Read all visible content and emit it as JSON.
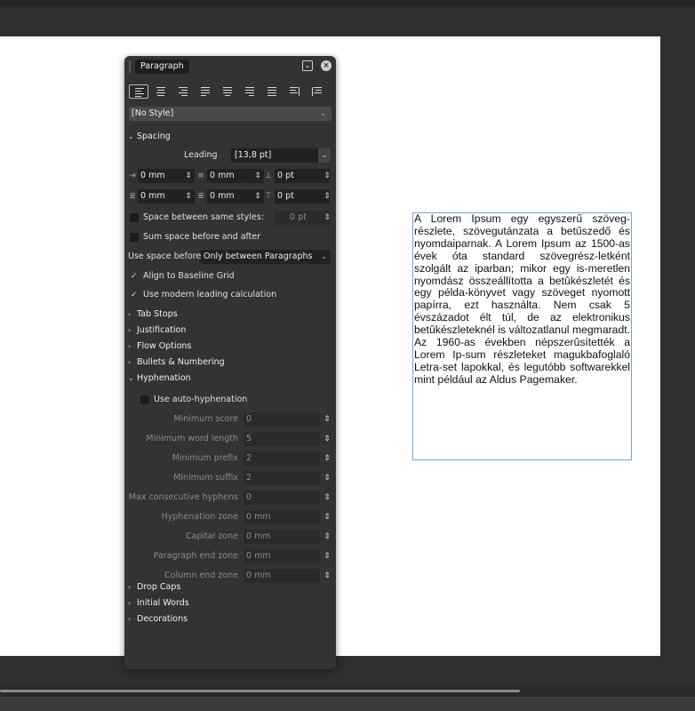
{
  "panel": {
    "tab_label": "Paragraph",
    "style_value": "[No Style]",
    "sections": {
      "spacing": "Spacing",
      "tab_stops": "Tab Stops",
      "justification": "Justification",
      "flow_options": "Flow Options",
      "bullets": "Bullets & Numbering",
      "hyphenation": "Hyphenation",
      "drop_caps": "Drop Caps",
      "initial_words": "Initial Words",
      "decorations": "Decorations"
    },
    "spacing": {
      "leading_label": "Leading",
      "leading_value": "[13,8 pt]",
      "left_indent": "0 mm",
      "first_line_indent": "0 mm",
      "space_before": "0 pt",
      "right_indent": "0 mm",
      "last_line_indent": "0 mm",
      "space_after": "0 pt",
      "space_between_same_label": "Space between same styles:",
      "space_between_same_value": "0 pt",
      "sum_space_label": "Sum space before and after",
      "use_space_before_label": "Use space before",
      "use_space_before_value": "Only between Paragraphs",
      "align_baseline_label": "Align to Baseline Grid",
      "modern_leading_label": "Use modern leading calculation"
    },
    "hyphenation": {
      "auto_label": "Use auto-hyphenation",
      "rows": [
        {
          "label": "Minimum score",
          "value": "0"
        },
        {
          "label": "Minimum word length",
          "value": "5"
        },
        {
          "label": "Minimum prefix",
          "value": "2"
        },
        {
          "label": "Minimum suffix",
          "value": "2"
        },
        {
          "label": "Max consecutive hyphens",
          "value": "0"
        },
        {
          "label": "Hyphenation zone",
          "value": "0 mm"
        },
        {
          "label": "Capital zone",
          "value": "0 mm"
        },
        {
          "label": "Paragraph end zone",
          "value": "0 mm"
        },
        {
          "label": "Column end zone",
          "value": "0 mm"
        }
      ]
    }
  },
  "document": {
    "text": "A Lorem Ipsum egy egyszerű szöveg-részlete, szövegutánzata a betűszedő és nyomdaiparnak. A Lorem Ipsum az 1500-as évek óta standard szövegrész-letként szolgált az iparban; mikor egy is-meretlen nyomdász összeállította a betûkészletét és egy példa-könyvet vagy szöveget nyomott papírra, ezt használta. Nem csak 5 évszázadot élt túl, de az elektronikus betûkészleteknél is változatlanul megmaradt. Az 1960-as években népszerûsítették a Lorem Ip-sum részleteket magukbafoglaló Letra-set lapokkal, és legutóbb softwarekkel mint például az Aldus Pagemaker."
  }
}
